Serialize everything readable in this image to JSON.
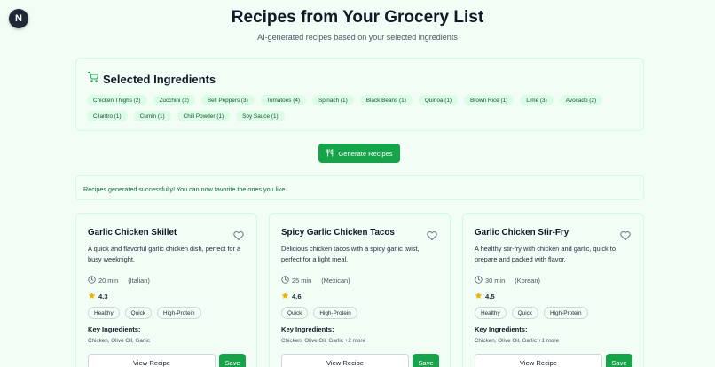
{
  "logo": {
    "letter": "N"
  },
  "header": {
    "title": "Recipes from Your Grocery List",
    "subtitle": "AI-generated recipes based on your selected ingredients"
  },
  "ingredients": {
    "heading": "Selected Ingredients",
    "icon": "shopping-cart-icon",
    "items": [
      "Chicken Thighs (2)",
      "Zucchini (2)",
      "Bell Peppers (3)",
      "Tomatoes (4)",
      "Spinach (1)",
      "Black Beans (1)",
      "Quinoa (1)",
      "Brown Rice (1)",
      "Lime (3)",
      "Avocado (2)",
      "Cilantro (1)",
      "Cumin (1)",
      "Chili Powder (1)",
      "Soy Sauce (1)"
    ]
  },
  "generate_button": {
    "label": "Generate Recipes",
    "icon": "utensils-icon"
  },
  "status_message": "Recipes generated successfully! You can now favorite the ones you like.",
  "colors": {
    "accent": "#16a34a",
    "background": "#f1fdf5",
    "chip_bg": "#dcfce7",
    "star": "#eab308"
  },
  "recipes": [
    {
      "title": "Garlic Chicken Skillet",
      "description": "A quick and flavorful garlic chicken dish, perfect for a busy weeknight.",
      "time": "20 min",
      "cuisine": "(Italian)",
      "rating": "4.3",
      "tags": [
        "Healthy",
        "Quick",
        "High-Protein"
      ],
      "key_label": "Key Ingredients:",
      "key_ingredients": "Chicken, Olive Oil, Garlic",
      "view_label": "View Recipe",
      "save_label": "Save"
    },
    {
      "title": "Spicy Garlic Chicken Tacos",
      "description": "Delicious chicken tacos with a spicy garlic twist, perfect for a light meal.",
      "time": "25 min",
      "cuisine": "(Mexican)",
      "rating": "4.6",
      "tags": [
        "Quick",
        "High-Protein"
      ],
      "key_label": "Key Ingredients:",
      "key_ingredients": "Chicken, Olive Oil, Garlic +2 more",
      "view_label": "View Recipe",
      "save_label": "Save"
    },
    {
      "title": "Garlic Chicken Stir-Fry",
      "description": "A healthy stir-fry with chicken and garlic, quick to prepare and packed with flavor.",
      "time": "30 min",
      "cuisine": "(Korean)",
      "rating": "4.5",
      "tags": [
        "Healthy",
        "Quick",
        "High-Protein"
      ],
      "key_label": "Key Ingredients:",
      "key_ingredients": "Chicken, Olive Oil, Garlic +1 more",
      "view_label": "View Recipe",
      "save_label": "Save"
    }
  ]
}
